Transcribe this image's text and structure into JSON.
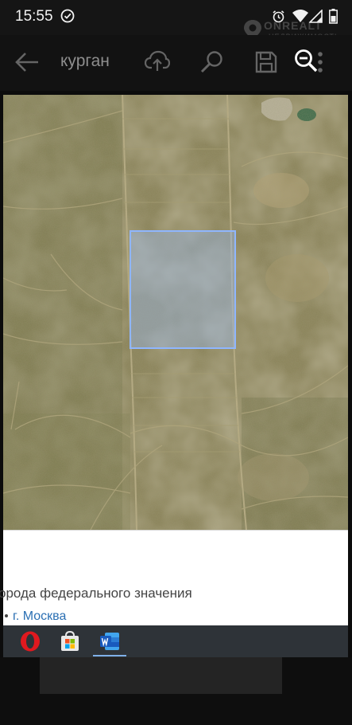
{
  "status_bar": {
    "time": "15:55",
    "watermark": "ONREALT",
    "watermark_sub": "НЕДВИЖИМОСТЬ"
  },
  "toolbar": {
    "title": "курган",
    "icons": [
      "back-arrow-icon",
      "cloud-upload-icon",
      "search-icon",
      "save-icon",
      "zoom-out-icon",
      "more-vertical-icon"
    ]
  },
  "map": {
    "type": "satellite",
    "highlight_color": "#8fb6ff"
  },
  "panel": {
    "heading": "орода федерального значения",
    "link": "г. Москва"
  },
  "taskbar": {
    "apps": [
      "opera-icon",
      "microsoft-store-icon",
      "word-icon"
    ]
  }
}
